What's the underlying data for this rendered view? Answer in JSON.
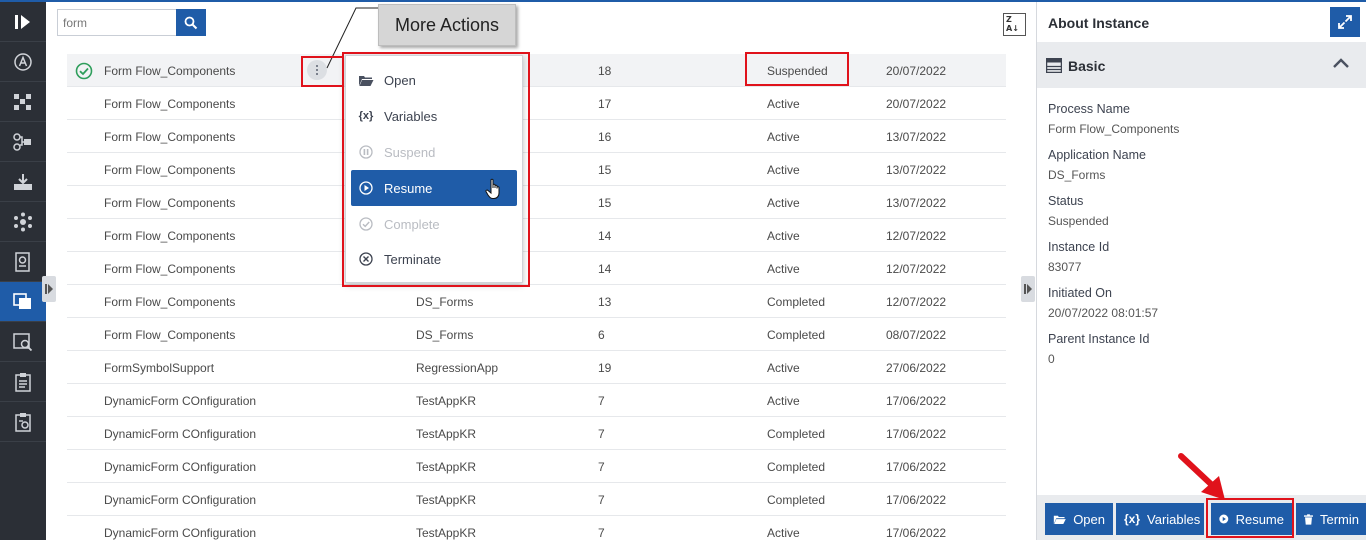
{
  "search": {
    "value": "form"
  },
  "callout": {
    "label": "More Actions"
  },
  "rows": [
    {
      "name": "Form Flow_Components",
      "app": "",
      "id": "18",
      "status": "Suspended",
      "date": "20/07/2022"
    },
    {
      "name": "Form Flow_Components",
      "app": "",
      "id": "17",
      "status": "Active",
      "date": "20/07/2022"
    },
    {
      "name": "Form Flow_Components",
      "app": "",
      "id": "16",
      "status": "Active",
      "date": "13/07/2022"
    },
    {
      "name": "Form Flow_Components",
      "app": "",
      "id": "15",
      "status": "Active",
      "date": "13/07/2022"
    },
    {
      "name": "Form Flow_Components",
      "app": "",
      "id": "15",
      "status": "Active",
      "date": "13/07/2022"
    },
    {
      "name": "Form Flow_Components",
      "app": "",
      "id": "14",
      "status": "Active",
      "date": "12/07/2022"
    },
    {
      "name": "Form Flow_Components",
      "app": "",
      "id": "14",
      "status": "Active",
      "date": "12/07/2022"
    },
    {
      "name": "Form Flow_Components",
      "app": "DS_Forms",
      "id": "13",
      "status": "Completed",
      "date": "12/07/2022"
    },
    {
      "name": "Form Flow_Components",
      "app": "DS_Forms",
      "id": "6",
      "status": "Completed",
      "date": "08/07/2022"
    },
    {
      "name": "FormSymbolSupport",
      "app": "RegressionApp",
      "id": "19",
      "status": "Active",
      "date": "27/06/2022"
    },
    {
      "name": "DynamicForm COnfiguration",
      "app": "TestAppKR",
      "id": "7",
      "status": "Active",
      "date": "17/06/2022"
    },
    {
      "name": "DynamicForm COnfiguration",
      "app": "TestAppKR",
      "id": "7",
      "status": "Completed",
      "date": "17/06/2022"
    },
    {
      "name": "DynamicForm COnfiguration",
      "app": "TestAppKR",
      "id": "7",
      "status": "Completed",
      "date": "17/06/2022"
    },
    {
      "name": "DynamicForm COnfiguration",
      "app": "TestAppKR",
      "id": "7",
      "status": "Completed",
      "date": "17/06/2022"
    },
    {
      "name": "DynamicForm COnfiguration",
      "app": "TestAppKR",
      "id": "7",
      "status": "Active",
      "date": "17/06/2022"
    }
  ],
  "menu": {
    "items": [
      {
        "label": "Open",
        "icon": "folder-open-icon",
        "state": "normal"
      },
      {
        "label": "Variables",
        "icon": "variables-icon",
        "state": "normal"
      },
      {
        "label": "Suspend",
        "icon": "pause-icon",
        "state": "disabled"
      },
      {
        "label": "Resume",
        "icon": "play-icon",
        "state": "selected"
      },
      {
        "label": "Complete",
        "icon": "check-circle-icon",
        "state": "disabled"
      },
      {
        "label": "Terminate",
        "icon": "close-circle-icon",
        "state": "normal"
      }
    ]
  },
  "panel": {
    "title": "About Instance",
    "section": "Basic",
    "fields": [
      {
        "label": "Process Name",
        "value": "Form Flow_Components"
      },
      {
        "label": "Application Name",
        "value": "DS_Forms"
      },
      {
        "label": "Status",
        "value": "Suspended"
      },
      {
        "label": "Instance Id",
        "value": "83077"
      },
      {
        "label": "Initiated On",
        "value": "20/07/2022 08:01:57"
      },
      {
        "label": "Parent Instance Id",
        "value": "0"
      }
    ],
    "buttons": {
      "open": "Open",
      "variables": "Variables",
      "variables_icon": "{x}",
      "resume": "Resume",
      "terminate": "Termin"
    }
  },
  "colors": {
    "accent": "#1f5ca8",
    "rail": "#2b2f36",
    "highlight": "#e0121b",
    "success": "#2e9e5b"
  }
}
